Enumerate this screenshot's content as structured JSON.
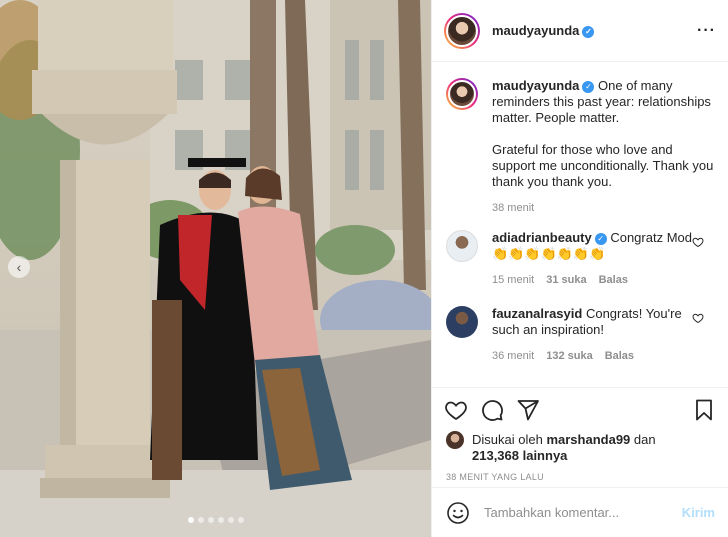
{
  "post": {
    "author": "maudyayunda",
    "verified": true
  },
  "header": {
    "username": "maudyayunda",
    "more_icon": "more-horizontal-icon"
  },
  "caption": {
    "username": "maudyayunda",
    "text": "One of many reminders this past year: relationships matter. People matter.\n\nGrateful for those who love and support me unconditionally. Thank you thank you thank you.",
    "time": "38 menit"
  },
  "comments": [
    {
      "username": "adiadrianbeauty",
      "verified": true,
      "text": "Congratz Mod 👏👏👏👏👏👏👏",
      "time": "15 menit",
      "likes": "31 suka",
      "reply": "Balas"
    },
    {
      "username": "fauzanalrasyid",
      "verified": false,
      "text": "Congrats! You're such an inspiration!",
      "time": "36 menit",
      "likes": "132 suka",
      "reply": "Balas"
    }
  ],
  "likes": {
    "prefix": "Disukai oleh",
    "user": "marshanda99",
    "middle": "dan",
    "count": "213,368 lainnya"
  },
  "posted": "38 MENIT YANG LALU",
  "add_comment": {
    "placeholder": "Tambahkan komentar...",
    "post_label": "Kirim"
  },
  "carousel": {
    "slide_count": 6,
    "active_index": 0
  },
  "colors": {
    "verified": "#3897f0",
    "post_button_disabled": "#b2dffc",
    "muted": "#8e8e8e"
  }
}
